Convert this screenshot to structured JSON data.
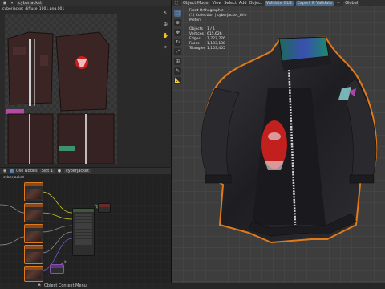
{
  "image_editor": {
    "filename": "cyberjacket_diffuse_1001.png.001",
    "side_icons": [
      "arrow-icon",
      "crosshair-icon",
      "hand-icon",
      "zoom-icon"
    ]
  },
  "viewport": {
    "mode": "Object Mode",
    "menu": [
      "View",
      "Select",
      "Add",
      "Object"
    ],
    "shading_btn": "Validate GLB",
    "extra_btn": "Export & Validate",
    "orientation": "Global",
    "overlay_title": "Front Orthographic",
    "overlay_collection": "(1) Collection | cyberjacket_thin",
    "overlay_units": "Meters",
    "stats": [
      {
        "label": "Objects",
        "value": "1 / 1"
      },
      {
        "label": "Vertices",
        "value": "615,626"
      },
      {
        "label": "Edges",
        "value": "1,722,776"
      },
      {
        "label": "Faces",
        "value": "1,103,138"
      },
      {
        "label": "Triangles",
        "value": "1,103,405"
      }
    ]
  },
  "node_editor": {
    "use_nodes_label": "Use Nodes",
    "slot_label": "Slot 1",
    "material_label": "cyberjacket",
    "breadcrumb": "cyberjacket"
  },
  "status_bar": {
    "context_label": "Object Context Menu"
  },
  "colors": {
    "accent_orange": "#e07a1b",
    "panel_bg": "#1d1d1d",
    "header_bg": "#303030",
    "viewport_bg": "#3d3d3d"
  }
}
